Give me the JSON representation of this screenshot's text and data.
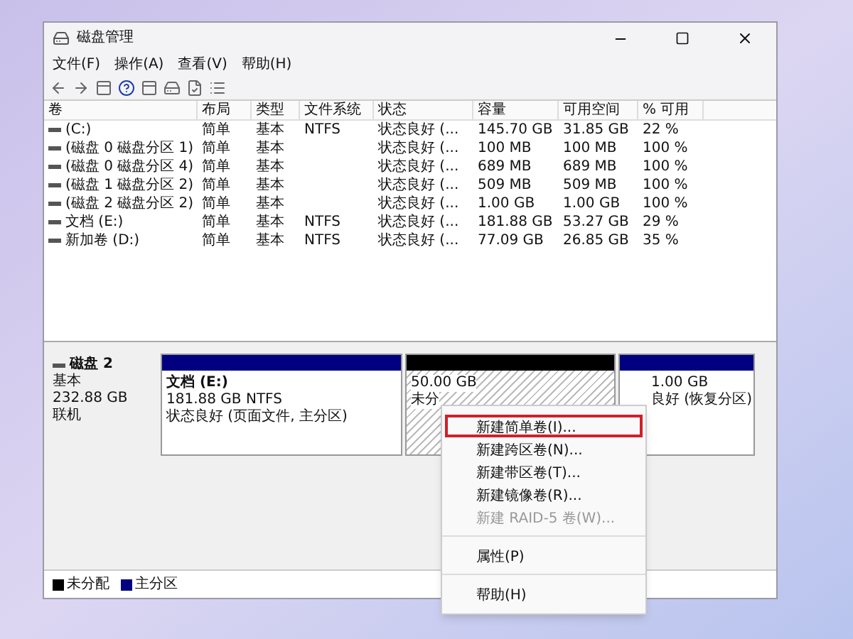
{
  "window": {
    "title": "磁盘管理"
  },
  "menu": [
    "文件(F)",
    "操作(A)",
    "查看(V)",
    "帮助(H)"
  ],
  "table": {
    "columns": [
      "卷",
      "布局",
      "类型",
      "文件系统",
      "状态",
      "容量",
      "可用空间",
      "% 可用"
    ],
    "rows": [
      [
        "(C:)",
        "简单",
        "基本",
        "NTFS",
        "状态良好 (...",
        "145.70 GB",
        "31.85 GB",
        "22 %"
      ],
      [
        "(磁盘 0 磁盘分区 1)",
        "简单",
        "基本",
        "",
        "状态良好 (...",
        "100 MB",
        "100 MB",
        "100 %"
      ],
      [
        "(磁盘 0 磁盘分区 4)",
        "简单",
        "基本",
        "",
        "状态良好 (...",
        "689 MB",
        "689 MB",
        "100 %"
      ],
      [
        "(磁盘 1 磁盘分区 2)",
        "简单",
        "基本",
        "",
        "状态良好 (...",
        "509 MB",
        "509 MB",
        "100 %"
      ],
      [
        "(磁盘 2 磁盘分区 2)",
        "简单",
        "基本",
        "",
        "状态良好 (...",
        "1.00 GB",
        "1.00 GB",
        "100 %"
      ],
      [
        "文档 (E:)",
        "简单",
        "基本",
        "NTFS",
        "状态良好 (...",
        "181.88 GB",
        "53.27 GB",
        "29 %"
      ],
      [
        "新加卷 (D:)",
        "简单",
        "基本",
        "NTFS",
        "状态良好 (...",
        "77.09 GB",
        "26.85 GB",
        "35 %"
      ]
    ]
  },
  "disk": {
    "name": "磁盘 2",
    "type": "基本",
    "size": "232.88 GB",
    "status": "联机",
    "partitions": [
      {
        "kind": "primary",
        "title": "文档  (E:)",
        "lines": [
          "181.88 GB NTFS",
          "状态良好 (页面文件, 主分区)"
        ]
      },
      {
        "kind": "unallocated",
        "lines": [
          "50.00 GB",
          "未分"
        ]
      },
      {
        "kind": "primary",
        "lines": [
          "1.00 GB",
          "良好 (恢复分区)"
        ]
      }
    ]
  },
  "legend": [
    {
      "label": "未分配",
      "color": "#000000"
    },
    {
      "label": "主分区",
      "color": "#000080"
    }
  ],
  "context_menu": [
    [
      {
        "label": "新建简单卷(I)...",
        "selected": true,
        "disabled": false
      },
      {
        "label": "新建跨区卷(N)...",
        "selected": false,
        "disabled": false
      },
      {
        "label": "新建带区卷(T)...",
        "selected": false,
        "disabled": false
      },
      {
        "label": "新建镜像卷(R)...",
        "selected": false,
        "disabled": false
      },
      {
        "label": "新建 RAID-5 卷(W)...",
        "selected": false,
        "disabled": true
      }
    ],
    [
      {
        "label": "属性(P)",
        "selected": false,
        "disabled": false
      }
    ],
    [
      {
        "label": "帮助(H)",
        "selected": false,
        "disabled": false
      }
    ]
  ]
}
